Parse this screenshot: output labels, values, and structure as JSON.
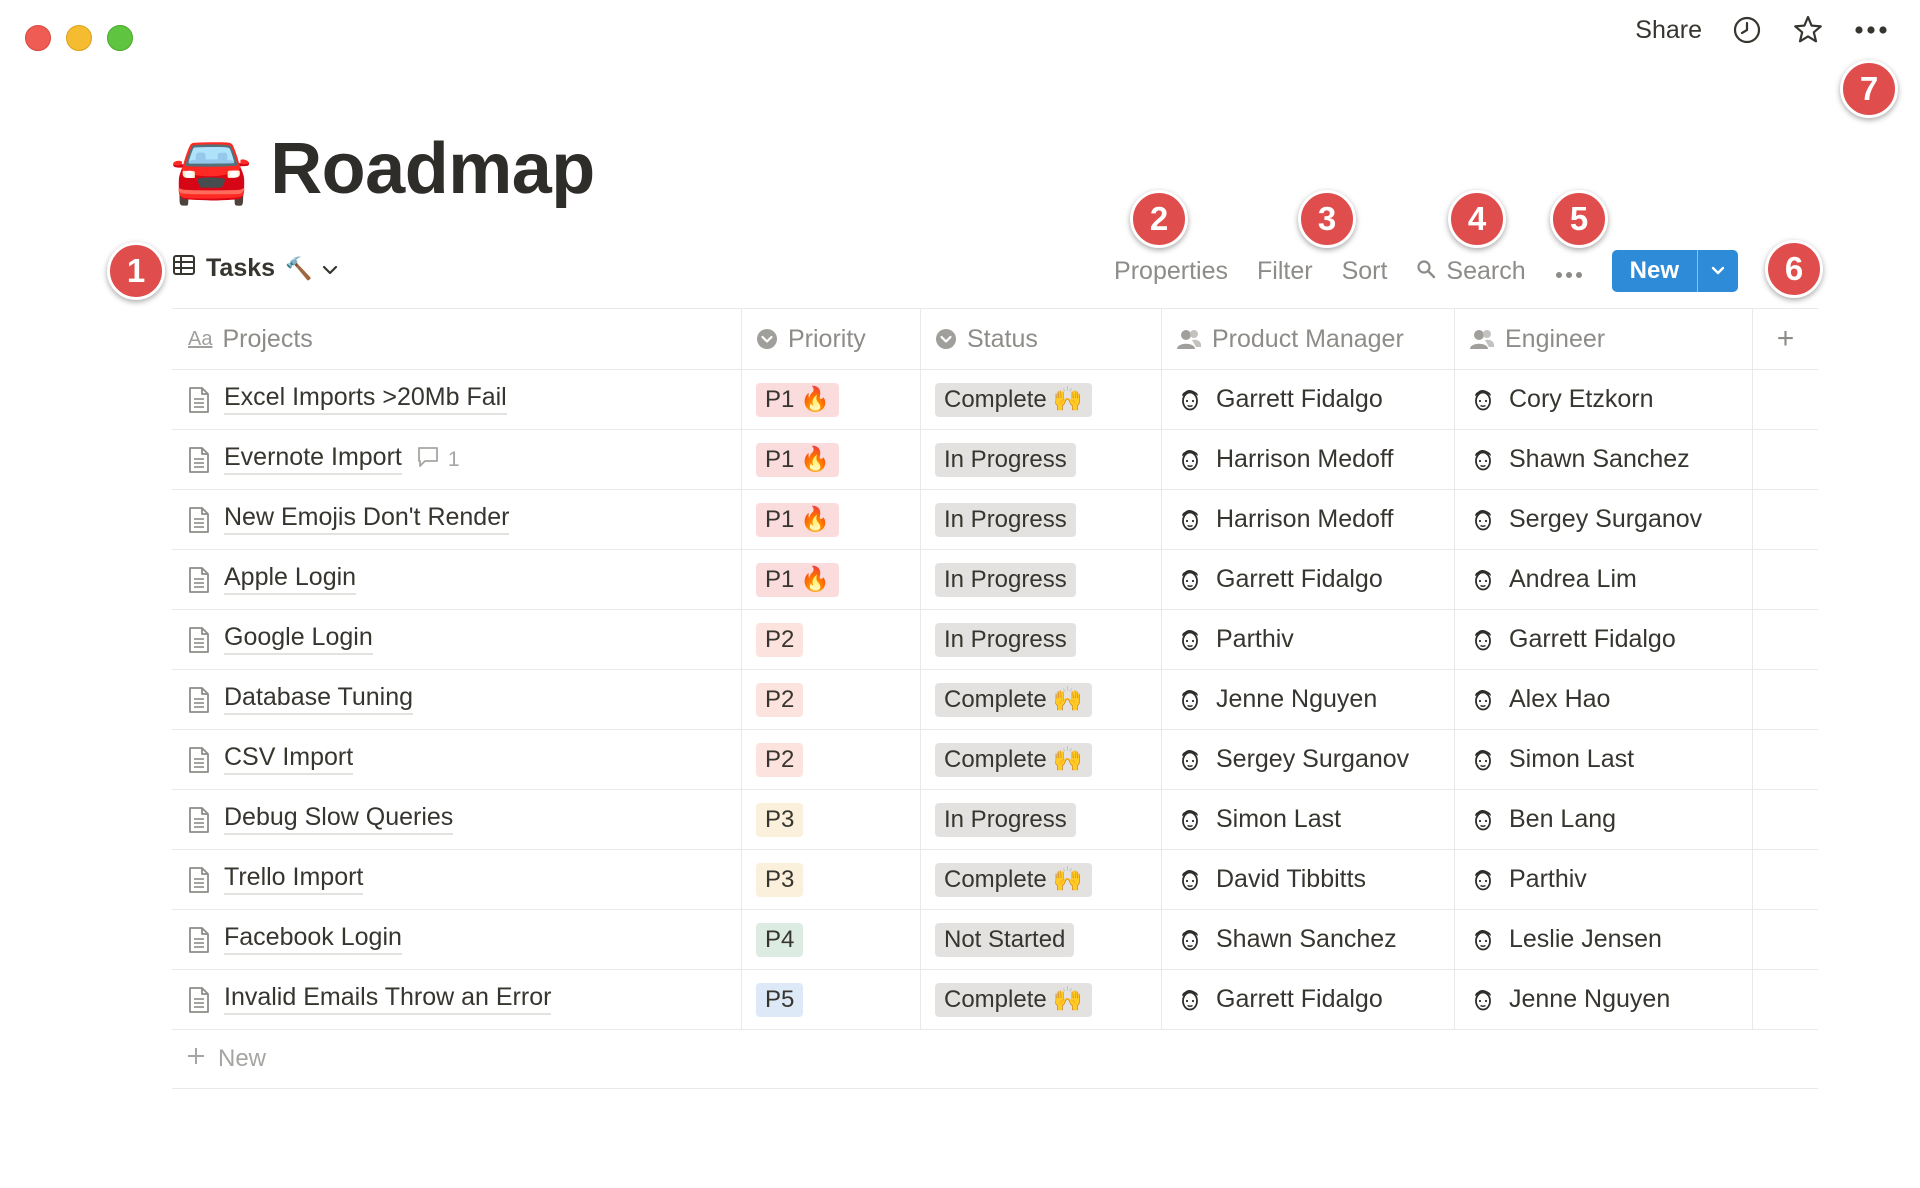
{
  "window": {
    "traffic_lights": [
      "close",
      "minimize",
      "zoom"
    ]
  },
  "topbar": {
    "share_label": "Share",
    "icons": [
      "clock-icon",
      "star-icon",
      "more-icon"
    ]
  },
  "page": {
    "emoji": "🚘",
    "title": "Roadmap"
  },
  "view": {
    "name": "Tasks",
    "name_emoji": "🔨"
  },
  "toolbar": {
    "properties_label": "Properties",
    "filter_label": "Filter",
    "sort_label": "Sort",
    "search_label": "Search",
    "new_label": "New"
  },
  "callouts": [
    "1",
    "2",
    "3",
    "4",
    "5",
    "6",
    "7"
  ],
  "table": {
    "columns": [
      "Projects",
      "Priority",
      "Status",
      "Product Manager",
      "Engineer"
    ],
    "add_column_label": "+",
    "rows": [
      {
        "project": "Excel Imports >20Mb Fail",
        "comments": "",
        "priority": "P1",
        "fire": "🔥",
        "status": "Complete",
        "status_emoji": "🙌",
        "pm": "Garrett Fidalgo",
        "engineer": "Cory Etzkorn"
      },
      {
        "project": "Evernote Import",
        "comments": "1",
        "priority": "P1",
        "fire": "🔥",
        "status": "In Progress",
        "status_emoji": "",
        "pm": "Harrison Medoff",
        "engineer": "Shawn Sanchez"
      },
      {
        "project": "New Emojis Don't Render",
        "comments": "",
        "priority": "P1",
        "fire": "🔥",
        "status": "In Progress",
        "status_emoji": "",
        "pm": "Harrison Medoff",
        "engineer": "Sergey Surganov"
      },
      {
        "project": "Apple Login",
        "comments": "",
        "priority": "P1",
        "fire": "🔥",
        "status": "In Progress",
        "status_emoji": "",
        "pm": "Garrett Fidalgo",
        "engineer": "Andrea Lim"
      },
      {
        "project": "Google Login",
        "comments": "",
        "priority": "P2",
        "fire": "",
        "status": "In Progress",
        "status_emoji": "",
        "pm": "Parthiv",
        "engineer": "Garrett Fidalgo"
      },
      {
        "project": "Database Tuning",
        "comments": "",
        "priority": "P2",
        "fire": "",
        "status": "Complete",
        "status_emoji": "🙌",
        "pm": "Jenne Nguyen",
        "engineer": "Alex Hao"
      },
      {
        "project": "CSV Import",
        "comments": "",
        "priority": "P2",
        "fire": "",
        "status": "Complete",
        "status_emoji": "🙌",
        "pm": "Sergey Surganov",
        "engineer": "Simon Last"
      },
      {
        "project": "Debug Slow Queries",
        "comments": "",
        "priority": "P3",
        "fire": "",
        "status": "In Progress",
        "status_emoji": "",
        "pm": "Simon Last",
        "engineer": "Ben Lang"
      },
      {
        "project": "Trello Import",
        "comments": "",
        "priority": "P3",
        "fire": "",
        "status": "Complete",
        "status_emoji": "🙌",
        "pm": "David Tibbitts",
        "engineer": "Parthiv"
      },
      {
        "project": "Facebook Login",
        "comments": "",
        "priority": "P4",
        "fire": "",
        "status": "Not Started",
        "status_emoji": "",
        "pm": "Shawn Sanchez",
        "engineer": "Leslie Jensen"
      },
      {
        "project": "Invalid Emails Throw an Error",
        "comments": "",
        "priority": "P5",
        "fire": "",
        "status": "Complete",
        "status_emoji": "🙌",
        "pm": "Garrett Fidalgo",
        "engineer": "Jenne Nguyen"
      }
    ],
    "new_row_label": "New"
  },
  "colors": {
    "accent": "#2e8bd8",
    "badge": "#e04d4d"
  }
}
